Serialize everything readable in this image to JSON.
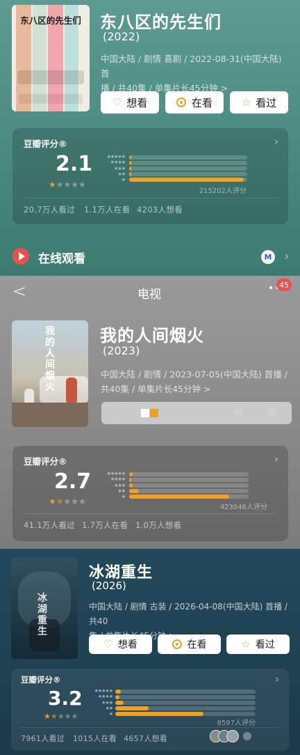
{
  "show1": {
    "poster_title": "东八区的先生们",
    "title": "东八区的先生们",
    "year": "(2022)",
    "meta_line1": "中国大陆 / 剧情 喜剧 / 2022-08-31(中国大陆) 首",
    "meta_line2": "播 / 共40集 / 单集片长45分钟 >",
    "buttons": {
      "want": "想看",
      "watching": "在看",
      "watched": "看过"
    },
    "rating": {
      "label": "豆瓣评分®",
      "score": "2.1",
      "stars_filled": 1,
      "distribution": [
        0.01,
        0.01,
        0.01,
        0.02,
        0.97
      ],
      "count": "215202人评分",
      "stats": [
        "20.7万人看过",
        "1.1万人在看",
        "4203人想看"
      ]
    },
    "online": {
      "label": "在线观看"
    }
  },
  "nav": {
    "back": "<",
    "title": "电视",
    "more": "•••",
    "badge": "45"
  },
  "show2": {
    "poster_title": "我的人间烟火",
    "title": "我的人间烟火",
    "year": "(2023)",
    "meta_line1": "中国大陆 / 剧情 / 2023-07-05(中国大陆) 首播 /",
    "meta_line2": "共40集 / 单集片长45分钟 >",
    "rating": {
      "label": "豆瓣评分®",
      "score": "2.7",
      "stars_filled": 1.5,
      "distribution": [
        0.03,
        0.02,
        0.03,
        0.08,
        0.84
      ],
      "count": "423046人评分",
      "stats": [
        "41.1万人看过",
        "1.7万人在看",
        "1.0万人想看"
      ]
    }
  },
  "show3": {
    "poster_title": "冰湖重生",
    "title": "冰湖重生",
    "year": "(2026)",
    "meta_line1": "中国大陆 / 剧情 古装 / 2026-04-08(中国大陆) 首播 / 共40",
    "meta_line2": "集 / 单集片长45分钟 >",
    "buttons": {
      "want": "想看",
      "watching": "在看",
      "watched": "看过"
    },
    "rating": {
      "label": "豆瓣评分®",
      "score": "3.2",
      "stars_filled": 1.5,
      "distribution": [
        0.04,
        0.03,
        0.06,
        0.24,
        0.63
      ],
      "count": "8597人评分",
      "stats": [
        "7961人看过",
        "1015人在看",
        "4657人想看"
      ]
    }
  },
  "colors": {
    "accent": "#f0a128",
    "badge": "#e8514d",
    "play": "#e8514d"
  }
}
